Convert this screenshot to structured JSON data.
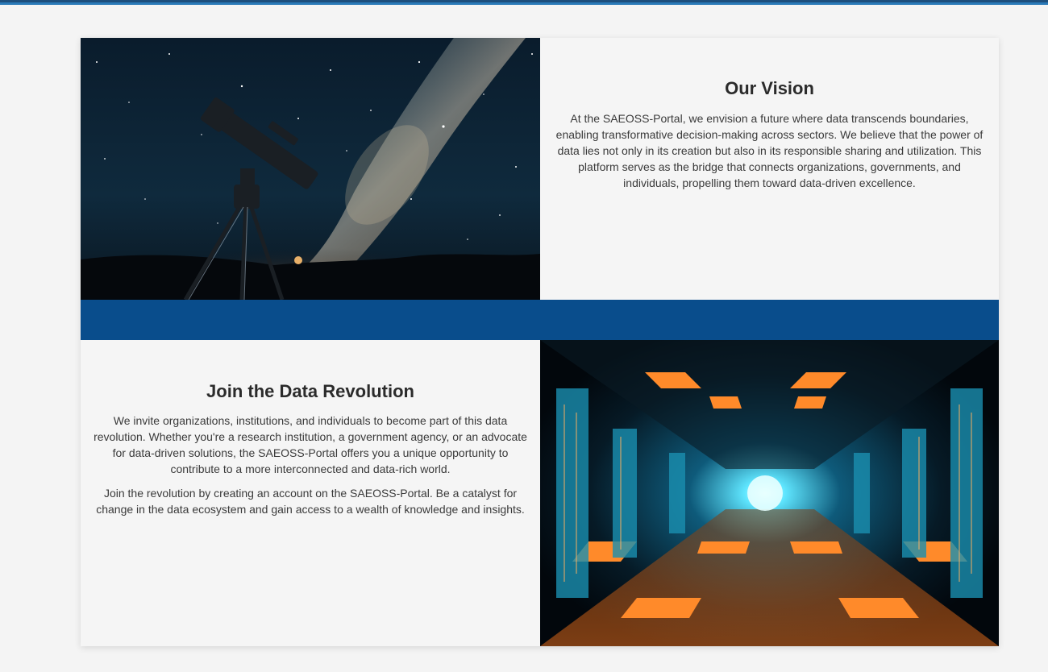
{
  "vision": {
    "title": "Our Vision",
    "body": "At the SAEOSS-Portal, we envision a future where data transcends boundaries, enabling transformative decision-making across sectors. We believe that the power of data lies not only in its creation but also in its responsible sharing and utilization. This platform serves as the bridge that connects organizations, governments, and individuals, propelling them toward data-driven excellence.",
    "image_icon": "telescope-milky-way-image"
  },
  "join": {
    "title": "Join the Data Revolution",
    "body_1": "We invite organizations, institutions, and individuals to become part of this data revolution. Whether you're a research institution, a government agency, or an advocate for data-driven solutions, the SAEOSS-Portal offers you a unique opportunity to contribute to a more interconnected and data-rich world.",
    "body_2": "Join the revolution by creating an account on the SAEOSS-Portal. Be a catalyst for change in the data ecosystem and gain access to a wealth of knowledge and insights.",
    "image_icon": "data-center-corridor-image"
  },
  "colors": {
    "topbar": "#1d4f7d",
    "band": "#094d8c",
    "card_bg": "#f5f5f5",
    "page_bg": "#f4f4f4"
  }
}
